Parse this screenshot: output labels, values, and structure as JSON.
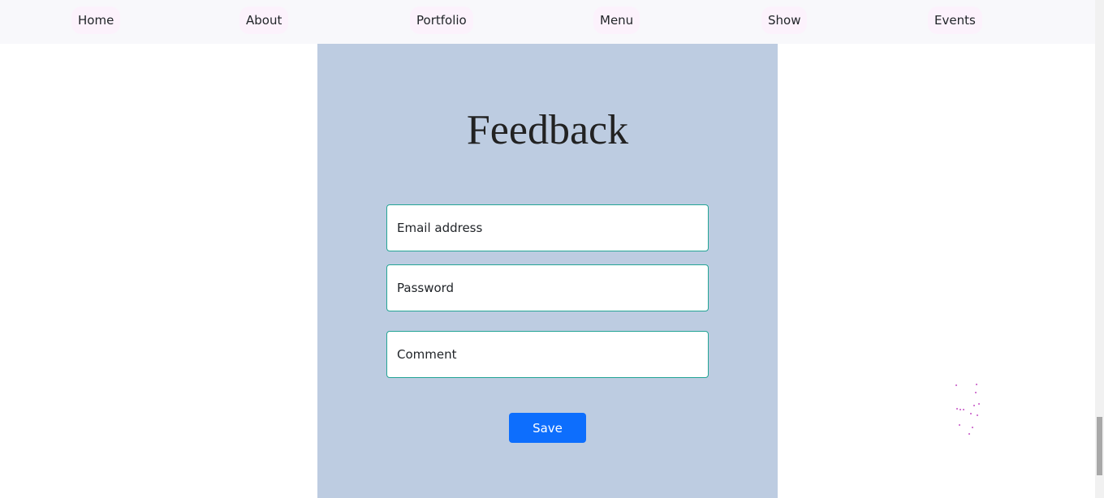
{
  "nav": {
    "items": [
      {
        "label": "Home"
      },
      {
        "label": "About"
      },
      {
        "label": "Portfolio"
      },
      {
        "label": "Menu"
      },
      {
        "label": "Show"
      },
      {
        "label": "Events"
      }
    ]
  },
  "feedback": {
    "title": "Feedback",
    "email_placeholder": "Email address",
    "password_placeholder": "Password",
    "comment_placeholder": "Comment",
    "save_label": "Save"
  },
  "colors": {
    "panel_background": "#bdcce1",
    "nav_background": "#f8f8fb",
    "nav_pill": "#fcf2fc",
    "input_border": "#23a495",
    "button": "#0d6efd"
  }
}
